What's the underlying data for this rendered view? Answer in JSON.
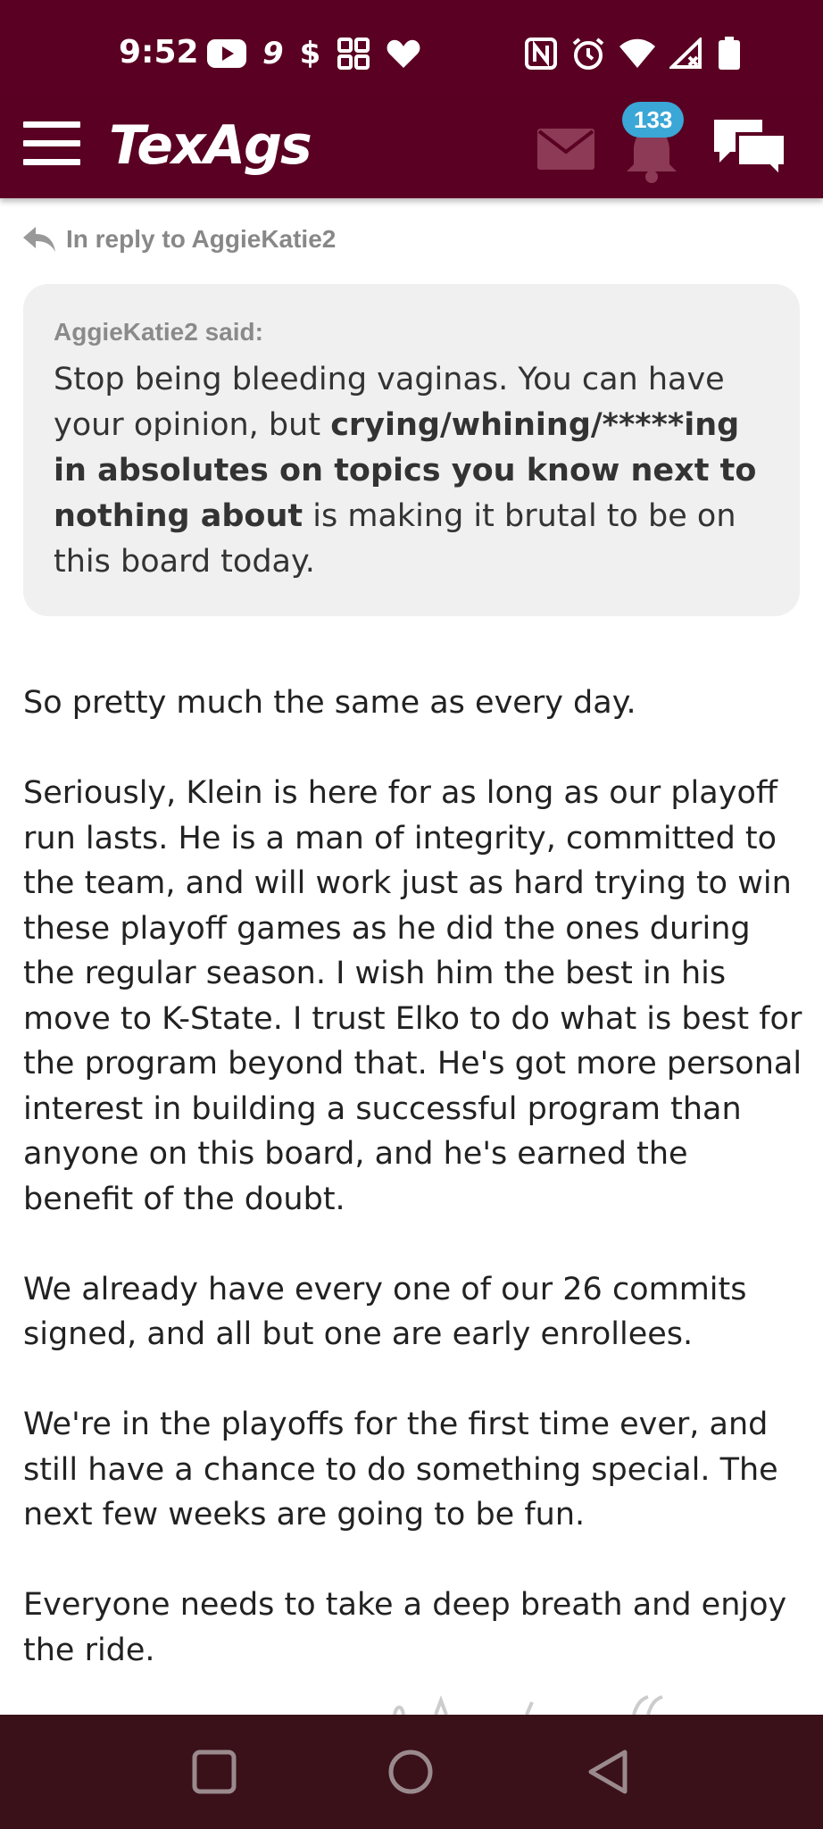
{
  "status_bar": {
    "time": "9:52",
    "left_icons": [
      "youtube-icon",
      "nine-icon",
      "dollar-icon",
      "grid-icon",
      "heart-icon"
    ],
    "right_icons": [
      "nfc-icon",
      "alarm-icon",
      "wifi-icon",
      "signal-icon",
      "battery-icon"
    ],
    "nine_label": "9",
    "dollar_label": "$"
  },
  "app_bar": {
    "logo": "TexAgs",
    "notification_count": "133",
    "background_color": "#5a0022",
    "badge_color": "#3aa7d6"
  },
  "post": {
    "reply_prefix": "In reply to AggieKatie2",
    "quote": {
      "author": "AggieKatie2 said:",
      "text_start": "Stop being bleeding vaginas. You can have your opinion, but ",
      "text_bold": "crying/whining/*****ing in absolutes on topics you know next to nothing about",
      "text_end": " is making it brutal to be on this board today."
    },
    "paragraphs": [
      "So pretty much the same as every day.",
      "Seriously, Klein is here for as long as our playoff run lasts. He is a man of integrity, committed to the team, and will work just as hard trying to win these playoff games as he did the ones during the regular season. I wish him the best in his move to K-State. I trust Elko to do what is best for the program beyond that. He's got more personal interest in building a successful program than anyone on this board, and he's earned the benefit of the doubt.",
      "We already have every one of our 26 commits signed, and all but one are early enrollees.",
      "We're in the playoffs for the first time ever, and still have a chance to do something special. The next few weeks are going to be fun.",
      "Everyone needs to take a deep breath and enjoy the ride."
    ]
  },
  "nav_bar": {
    "buttons": [
      "recents-square-icon",
      "home-circle-icon",
      "back-triangle-icon"
    ],
    "background_color": "#3a1119"
  }
}
